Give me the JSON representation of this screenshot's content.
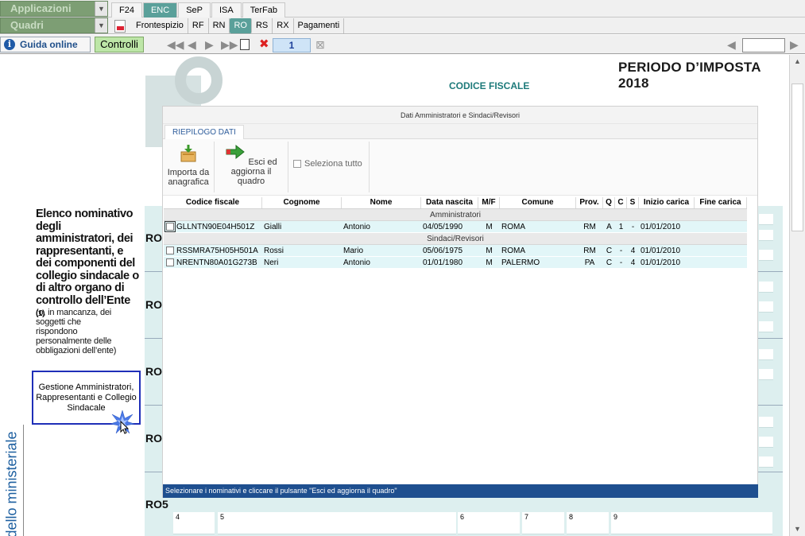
{
  "toolbar": {
    "applicazioni_label": "Applicazioni",
    "quadri_label": "Quadri",
    "modules": [
      {
        "label": "F24",
        "active": false
      },
      {
        "label": "ENC",
        "active": true
      },
      {
        "label": "SeP",
        "active": false
      },
      {
        "label": "ISA",
        "active": false
      },
      {
        "label": "TerFab",
        "active": false
      }
    ],
    "sections": [
      {
        "label": "Frontespizio",
        "active": false
      },
      {
        "label": "RF",
        "active": false
      },
      {
        "label": "RN",
        "active": false
      },
      {
        "label": "RO",
        "active": true
      },
      {
        "label": "RS",
        "active": false
      },
      {
        "label": "RX",
        "active": false
      },
      {
        "label": "Pagamenti",
        "active": false
      }
    ],
    "guida_label": "Guida online",
    "controlli_label": "Controlli",
    "page_number": "1",
    "accent_color": "#5aa09a"
  },
  "document": {
    "periodo": "PERIODO D’IMPOSTA 2018",
    "codice_fiscale_label": "CODICE FISCALE",
    "left_title": "Elenco nominativo degli amministratori, dei rappresentanti, e dei componenti del collegio sindacale o di altro organo di controllo dell’Ente",
    "left_title_note": "(1)",
    "left_subtitle": "(o, in mancanza, dei soggetti che rispondono personalmente delle obbligazioni dell’ente)",
    "gestione_button": "Gestione Amministratori, Rappresentanti e Collegio Sindacale",
    "side_text": "dello ministeriale",
    "row_labels": [
      "RO",
      "RO2",
      "RO3",
      "RO4",
      "RO5"
    ],
    "field_numbers": [
      "4",
      "5",
      "6",
      "7",
      "8",
      "9"
    ]
  },
  "modal": {
    "title": "Dati Amministratori e Sindaci/Revisori",
    "tab": "RIEPILOGO DATI",
    "import_button": "Importa da anagrafica",
    "exit_button": "Esci ed aggiorna il quadro",
    "select_all": "Seleziona tutto",
    "columns": [
      "Codice fiscale",
      "Cognome",
      "Nome",
      "Data nascita",
      "M/F",
      "Comune",
      "Prov.",
      "Q",
      "C",
      "S",
      "Inizio carica",
      "Fine carica"
    ],
    "groups": [
      {
        "label": "Amministratori",
        "rows": [
          {
            "cf": "GLLNTN90E04H501Z",
            "cognome": "Gialli",
            "nome": "Antonio",
            "data": "04/05/1990",
            "mf": "M",
            "comune": "ROMA",
            "prov": "RM",
            "q": "A",
            "c": "1",
            "s": "-",
            "inizio": "01/01/2010",
            "fine": ""
          }
        ]
      },
      {
        "label": "Sindaci/Revisori",
        "rows": [
          {
            "cf": "RSSMRA75H05H501A",
            "cognome": "Rossi",
            "nome": "Mario",
            "data": "05/06/1975",
            "mf": "M",
            "comune": "ROMA",
            "prov": "RM",
            "q": "C",
            "c": "-",
            "s": "4",
            "inizio": "01/01/2010",
            "fine": ""
          },
          {
            "cf": "NRENTN80A01G273B",
            "cognome": "Neri",
            "nome": "Antonio",
            "data": "01/01/1980",
            "mf": "M",
            "comune": "PALERMO",
            "prov": "PA",
            "q": "C",
            "c": "-",
            "s": "4",
            "inizio": "01/01/2010",
            "fine": ""
          }
        ]
      }
    ],
    "status_text": "Selezionare i nominativi e cliccare il pulsante \"Esci ed aggiorna il quadro\""
  }
}
